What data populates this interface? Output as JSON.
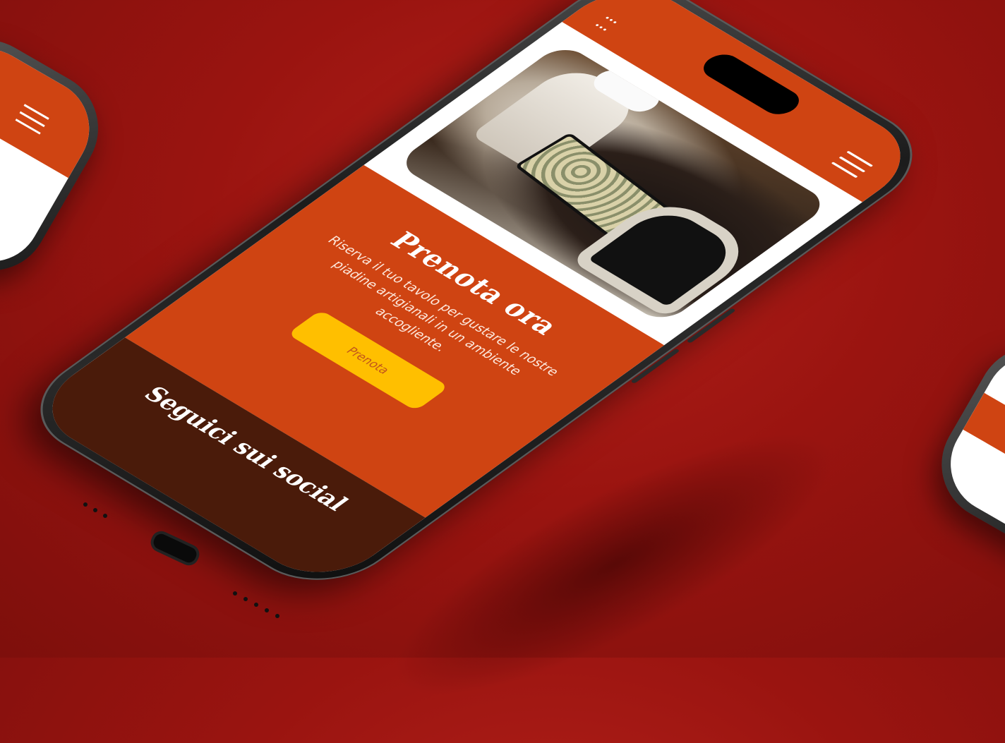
{
  "brand": {
    "line1": "...",
    "line2": "..."
  },
  "menu": {
    "icon": "hamburger-icon"
  },
  "hero": {
    "image_alt": "Chef placing a tray of piadine into a wood oven"
  },
  "booking": {
    "title": "Prenota ora",
    "description": "Riserva il tuo tavolo per gustare le nostre piadine artigianali in un ambiente accogliente.",
    "button_label": "Prenota"
  },
  "social": {
    "title": "Seguici sui social"
  },
  "colors": {
    "background": "#9a1410",
    "accent": "#cf4412",
    "button": "#ffbf00",
    "footer": "#4a1b0a"
  }
}
